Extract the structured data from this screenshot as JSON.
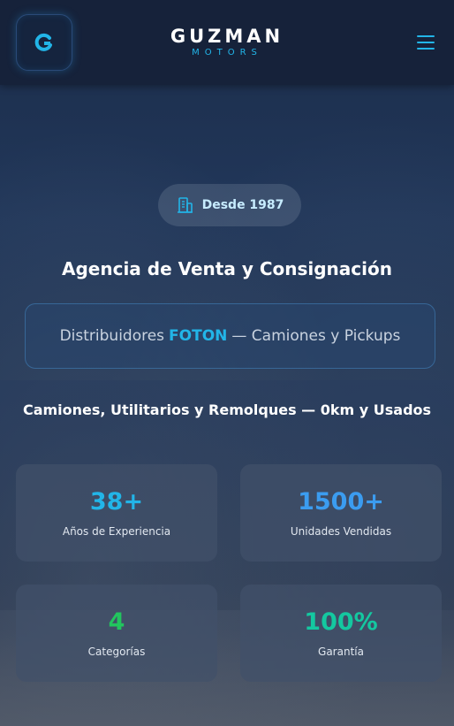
{
  "header": {
    "brand_name": "GUZMAN",
    "brand_sub": "MOTORS",
    "logo_icon": "g-logo-icon",
    "menu_icon": "hamburger-icon"
  },
  "hero": {
    "badge_label": "Desde 1987",
    "badge_icon": "building-icon",
    "headline": "Agencia de Venta y Consignación",
    "distributor": {
      "prefix": "Distribuidores",
      "brand": "FOTON",
      "suffix": "— Camiones y Pickups"
    },
    "tagline": "Camiones, Utilitarios y Remolques — 0km y Usados"
  },
  "stats": [
    {
      "value": "38+",
      "label": "Años de Experiencia",
      "color": "#22b5e8"
    },
    {
      "value": "1500+",
      "label": "Unidades Vendidas",
      "color": "#3b9cf0"
    },
    {
      "value": "4",
      "label": "Categorías",
      "color": "#22c55e"
    },
    {
      "value": "100%",
      "label": "Garantía",
      "color": "#14c8a0"
    }
  ],
  "colors": {
    "accent": "#22b5e8",
    "header_bg": "#16223a"
  }
}
